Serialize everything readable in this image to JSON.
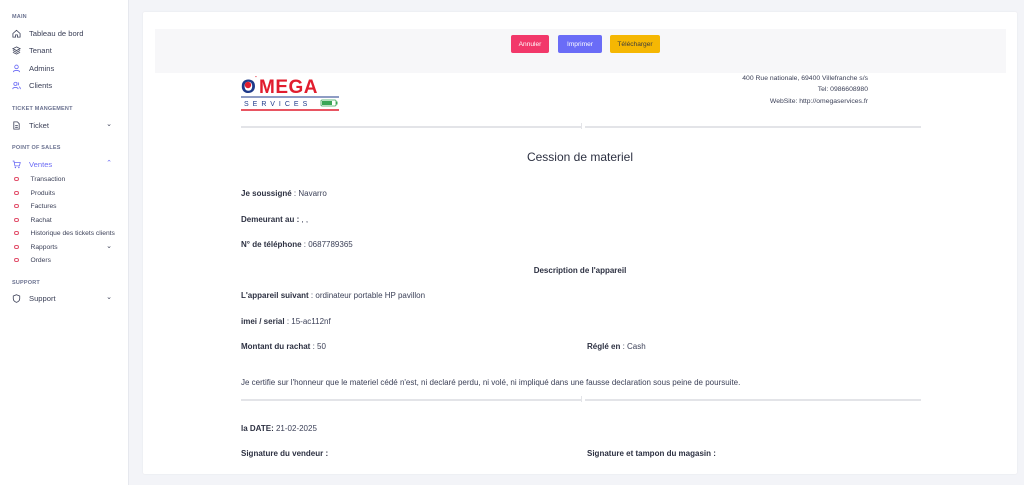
{
  "sidebar": {
    "sections": {
      "main": "MAIN",
      "ticket": "TICKET MANGEMENT",
      "pos": "POINT OF SALES",
      "support": "SUPPORT"
    },
    "items": {
      "dashboard": "Tableau de bord",
      "tenant": "Tenant",
      "admins": "Admins",
      "clients": "Clients",
      "ticket": "Ticket",
      "ventes": "Ventes",
      "support": "Support"
    },
    "sub_items": [
      "Transaction",
      "Produits",
      "Factures",
      "Rachat",
      "Historique des tickets clients",
      "Rapports",
      "Orders"
    ],
    "accent_color": "#6c6cf5",
    "dot_color": "#e2506b"
  },
  "toolbar": {
    "cancel_label": "Annuler",
    "print_label": "Imprimer",
    "download_label": "Télécharger"
  },
  "company": {
    "logo_top": "O'MEGA",
    "logo_bottom": "SERVICES",
    "address": "400 Rue nationale, 69400 Villefranche s/s",
    "tel": "Tel: 0986608980",
    "website": "WebSite: http://omegaservices.fr"
  },
  "document": {
    "title": "Cession de materiel",
    "soussigne_label": "Je soussigné",
    "soussigne_value": "Navarro",
    "demeurant_label": "Demeurant au :",
    "demeurant_value": ", ,",
    "phone_label": "N° de téléphone",
    "phone_value": "0687789365",
    "device_section": "Description de l'appareil",
    "appareil_label": "L'appareil suivant",
    "appareil_value": "ordinateur portable HP pavillon",
    "imei_label": "imei / serial",
    "imei_value": "15-ac112nf",
    "montant_label": "Montant du rachat",
    "montant_value": "50",
    "regle_label": "Réglé en",
    "regle_value": "Cash",
    "certify_text": "Je certifie sur l'honneur que le materiel cédé n'est, ni declaré perdu, ni volé, ni impliqué dans une fausse declaration sous peine de poursuite.",
    "date_label": "la DATE:",
    "date_value": "21-02-2025",
    "sig_vendor": "Signature du vendeur :",
    "sig_shop": "Signature et tampon du magasin :"
  }
}
